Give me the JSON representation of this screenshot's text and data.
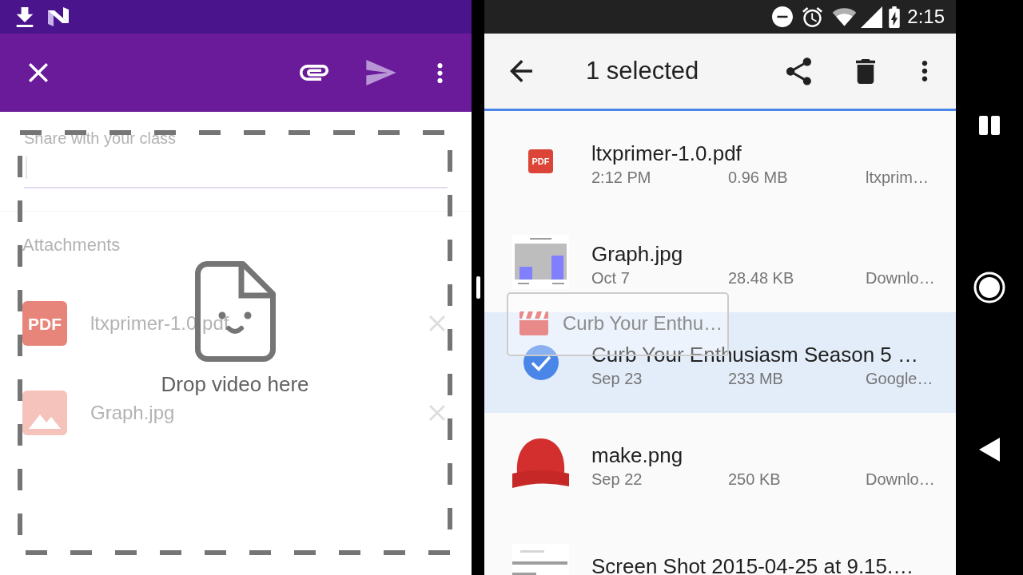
{
  "left_app": {
    "toolbar": {
      "send": {
        "disabled": true
      }
    },
    "share_field": {
      "label": "Share with your class",
      "focused": true
    },
    "attachments": {
      "title": "Attachments",
      "items": [
        {
          "kind": "pdf",
          "type_label": "PDF",
          "name": "ltxprimer-1.0.pdf"
        },
        {
          "kind": "image",
          "name": "Graph.jpg"
        }
      ]
    },
    "drop_zone": {
      "label": "Drop video here"
    }
  },
  "right_app": {
    "status_bar": {
      "time": "2:15"
    },
    "toolbar": {
      "title": "1 selected"
    },
    "files": [
      {
        "kind": "pdf",
        "type_label": "PDF",
        "name": "ltxprimer-1.0.pdf",
        "date": "2:12 PM",
        "size": "0.96 MB",
        "location": "ltxprim…",
        "selected": false
      },
      {
        "kind": "chart",
        "name": "Graph.jpg",
        "date": "Oct 7",
        "size": "28.48 KB",
        "location": "Downlo…",
        "selected": false
      },
      {
        "name": "Curb Your Enthusiasm Season 5 …",
        "date": "Sep 23",
        "size": "233 MB",
        "location": "Google…",
        "selected": true
      },
      {
        "kind": "photo",
        "name": "make.png",
        "date": "Sep 22",
        "size": "250 KB",
        "location": "Downlo…",
        "selected": false
      },
      {
        "kind": "screenshot",
        "name": "Screen Shot 2015-04-25 at 9.15.…",
        "selected": false
      }
    ],
    "drag_shadow": {
      "kind": "video",
      "label": "Curb Your Enthu…"
    }
  }
}
